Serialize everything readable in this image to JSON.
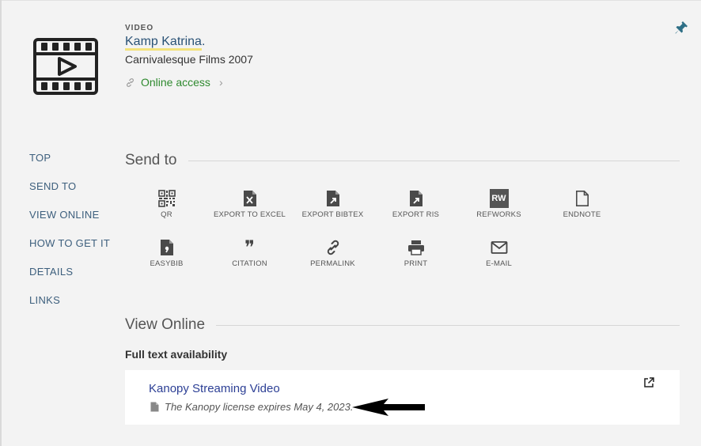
{
  "record": {
    "type": "VIDEO",
    "title": "Kamp Katrina",
    "title_suffix": ".",
    "publisher": "Carnivalesque Films 2007",
    "online_access": "Online access"
  },
  "nav": {
    "items": [
      {
        "label": "TOP"
      },
      {
        "label": "SEND TO"
      },
      {
        "label": "VIEW ONLINE"
      },
      {
        "label": "HOW TO GET IT"
      },
      {
        "label": "DETAILS"
      },
      {
        "label": "LINKS"
      }
    ]
  },
  "send_to": {
    "heading": "Send to",
    "actions": [
      {
        "label": "QR",
        "icon": "qr-code-icon"
      },
      {
        "label": "EXPORT TO EXCEL",
        "icon": "excel-icon"
      },
      {
        "label": "EXPORT BIBTEX",
        "icon": "bibtex-icon"
      },
      {
        "label": "EXPORT RIS",
        "icon": "ris-icon"
      },
      {
        "label": "REFWORKS",
        "icon": "refworks-icon",
        "icon_text": "RW"
      },
      {
        "label": "ENDNOTE",
        "icon": "endnote-icon"
      },
      {
        "label": "EASYBIB",
        "icon": "easybib-icon"
      },
      {
        "label": "CITATION",
        "icon": "quote-icon",
        "icon_text": "❞"
      },
      {
        "label": "PERMALINK",
        "icon": "link-icon"
      },
      {
        "label": "PRINT",
        "icon": "printer-icon"
      },
      {
        "label": "E-MAIL",
        "icon": "envelope-icon"
      }
    ]
  },
  "view_online": {
    "heading": "View Online",
    "subheading": "Full text availability",
    "service_link": "Kanopy Streaming Video",
    "note": "The Kanopy license expires May 4, 2023."
  },
  "colors": {
    "accent_link": "#2a5276",
    "online_green": "#2f8a2f",
    "nav_link": "#3d5f7d",
    "service_link": "#2c3f95",
    "highlight": "#f3e27a",
    "pin": "#2e6f86"
  }
}
